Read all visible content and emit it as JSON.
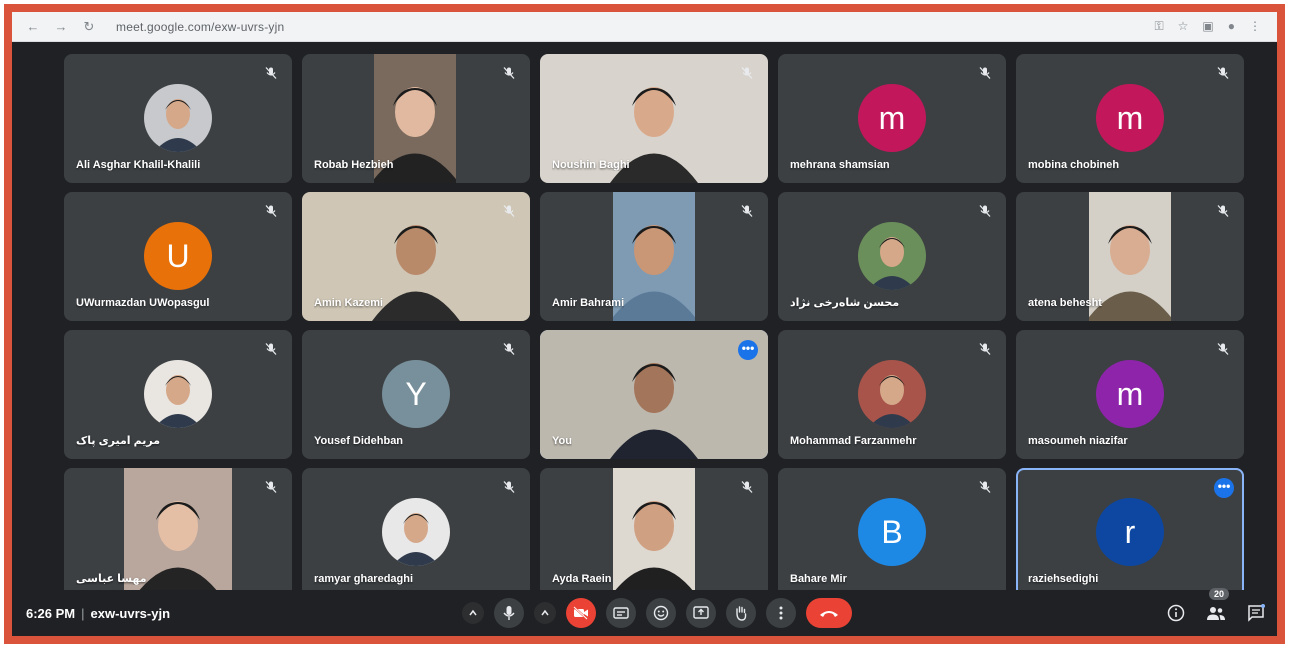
{
  "browser": {
    "url": "meet.google.com/exw-uvrs-yjn"
  },
  "participants": [
    {
      "name": "Ali Asghar Khalil-Khalili",
      "kind": "photo-avatar"
    },
    {
      "name": "Robab Hezbieh",
      "kind": "video"
    },
    {
      "name": "Noushin Baghi",
      "kind": "video"
    },
    {
      "name": "mehrana shamsian",
      "kind": "letter",
      "letter": "m",
      "color": "#c2185b"
    },
    {
      "name": "mobina chobineh",
      "kind": "letter",
      "letter": "m",
      "color": "#c2185b"
    },
    {
      "name": "UWurmazdan UWopasgul",
      "kind": "letter",
      "letter": "U",
      "color": "#e8710a"
    },
    {
      "name": "Amin Kazemi",
      "kind": "video"
    },
    {
      "name": "Amir Bahrami",
      "kind": "video"
    },
    {
      "name": "محسن شاه‌رخی نژاد",
      "kind": "photo-avatar"
    },
    {
      "name": "atena behesht",
      "kind": "video"
    },
    {
      "name": "مریم امیری پاک",
      "kind": "photo-avatar"
    },
    {
      "name": "Yousef Didehban",
      "kind": "letter",
      "letter": "Y",
      "color": "#78909c"
    },
    {
      "name": "You",
      "kind": "video"
    },
    {
      "name": "Mohammad Farzanmehr",
      "kind": "photo-avatar"
    },
    {
      "name": "masoumeh niazifar",
      "kind": "letter",
      "letter": "m",
      "color": "#8e24aa"
    },
    {
      "name": "مهسا عباسی",
      "kind": "video"
    },
    {
      "name": "ramyar gharedaghi",
      "kind": "photo-avatar"
    },
    {
      "name": "Ayda Raein",
      "kind": "video"
    },
    {
      "name": "Bahare Mir",
      "kind": "letter",
      "letter": "B",
      "color": "#1e88e5"
    },
    {
      "name": "raziehsedighi",
      "kind": "letter",
      "letter": "r",
      "color": "#0d47a1"
    }
  ],
  "bottom": {
    "time": "6:26 PM",
    "meeting_code": "exw-uvrs-yjn",
    "participant_count": "20"
  },
  "icons": {
    "mute": "mic-off-icon",
    "more": "more-options-icon"
  }
}
